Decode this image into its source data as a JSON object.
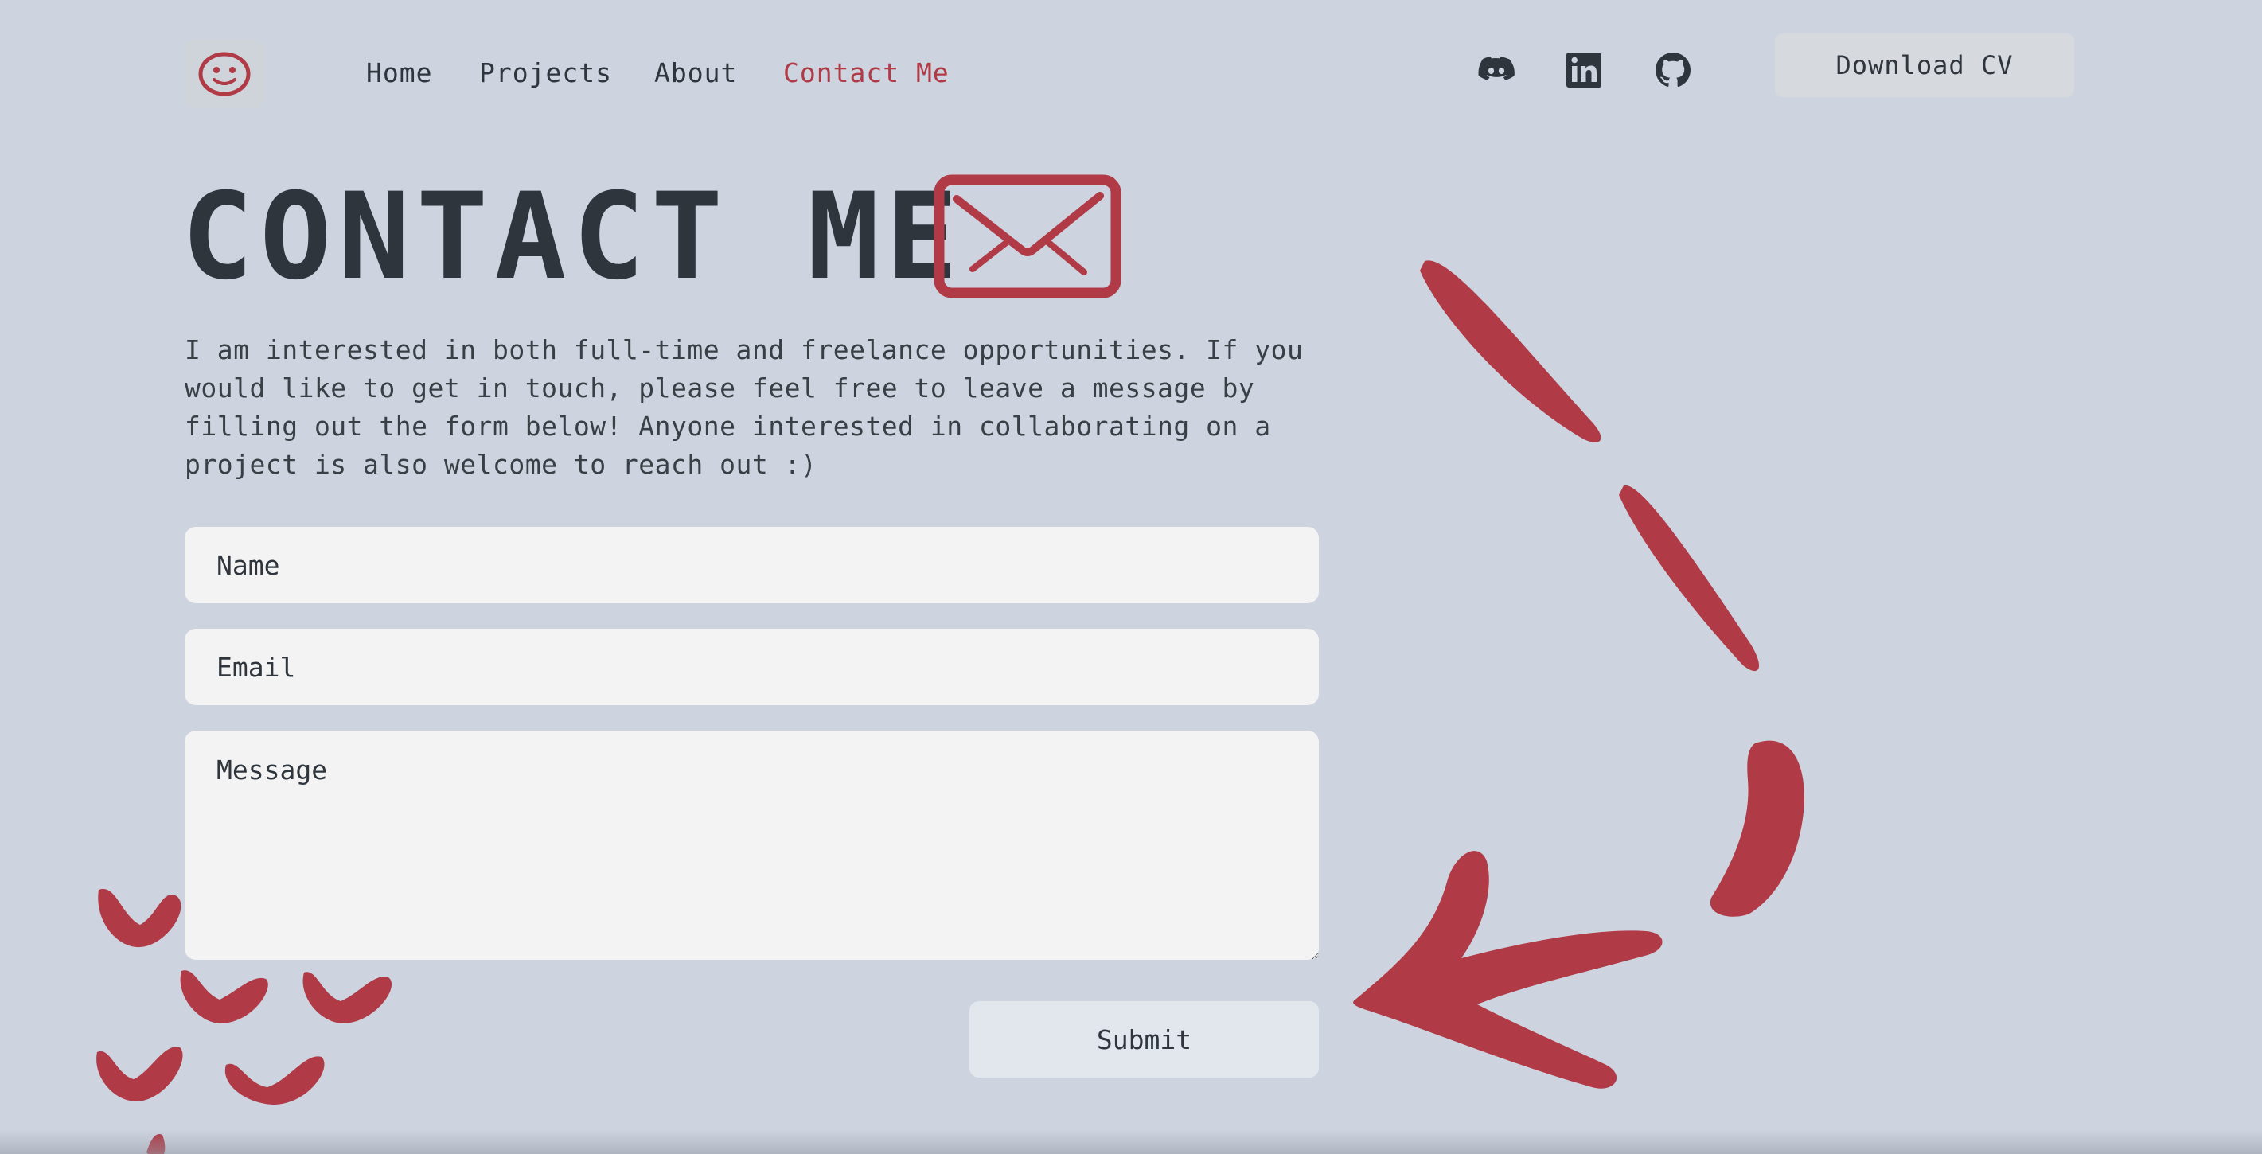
{
  "nav": {
    "links": [
      {
        "label": "Home"
      },
      {
        "label": "Projects"
      },
      {
        "label": "About"
      },
      {
        "label": "Contact Me",
        "active": true
      }
    ],
    "social_icons": [
      "discord-icon",
      "linkedin-icon",
      "github-icon"
    ],
    "cv_button_label": "Download CV"
  },
  "main": {
    "title": "CONTACT ME",
    "title_icon": "envelope-icon",
    "intro": "I am interested in both full-time and freelance opportunities. If you would like to get in touch, please feel free to leave a message by filling out the form below! Anyone interested in collaborating on a project is also welcome to reach out :)"
  },
  "form": {
    "name_placeholder": "Name",
    "email_placeholder": "Email",
    "message_placeholder": "Message",
    "submit_label": "Submit"
  },
  "colors": {
    "background": "#cdd4df",
    "accent": "#b03a46",
    "text": "#2f353d",
    "field_background": "#f3f3f3"
  }
}
